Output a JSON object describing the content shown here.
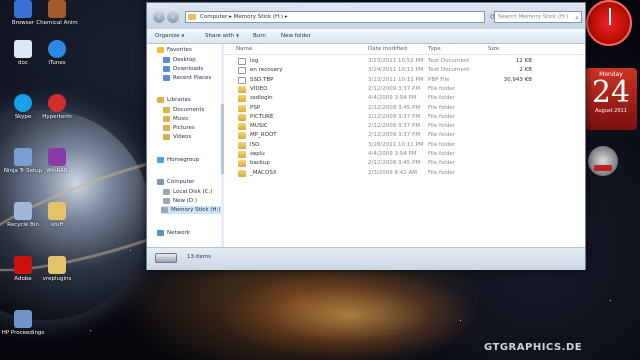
{
  "desktop": {
    "icons": [
      {
        "label": "Browser",
        "color": "#3a6fd8"
      },
      {
        "label": "Chemical Anim",
        "color": "#a45b2c"
      },
      {
        "label": "doc",
        "color": "#dfe6f3"
      },
      {
        "label": "iTunes",
        "color": "#2c88e0"
      },
      {
        "label": "Skype",
        "color": "#16a1e6"
      },
      {
        "label": "Hyperterm",
        "color": "#d12f2f"
      },
      {
        "label": "Ninja Tr Setup",
        "color": "#7a9ed1"
      },
      {
        "label": "WinRAR",
        "color": "#8a3aa8"
      },
      {
        "label": "Recycle Bin",
        "color": "#9fb7d4"
      },
      {
        "label": "stuff",
        "color": "#e2c36a"
      },
      {
        "label": "Adobe",
        "color": "#cc1111"
      },
      {
        "label": "vreplugins",
        "color": "#e2c36a"
      },
      {
        "label": "HP Proceedings",
        "color": "#6f95c8"
      }
    ],
    "calendar": {
      "month": "Monday",
      "day": "24",
      "year": "August 2011"
    },
    "gauge_label": "",
    "watermark": "GTGRAPHICS.DE"
  },
  "window": {
    "address": "Computer ▸ Memory Stick (H:) ▸",
    "search_placeholder": "Search Memory Stick (H:)",
    "toolbar": {
      "organize": "Organize",
      "share": "Share with",
      "burn": "Burn",
      "new_folder": "New folder"
    },
    "nav": {
      "favorites": "Favorites",
      "desktop": "Desktop",
      "downloads": "Downloads",
      "recent": "Recent Places",
      "libraries": "Libraries",
      "documents": "Documents",
      "music": "Music",
      "pictures": "Pictures",
      "videos": "Videos",
      "homegroup": "Homegroup",
      "computer": "Computer",
      "local_disk": "Local Disk (C:)",
      "new_vol": "New (D:)",
      "memory_stick": "Memory Stick (H:)",
      "network": "Network"
    },
    "columns": {
      "name": "Name",
      "date": "Date modified",
      "type": "Type",
      "size": "Size"
    },
    "files": [
      {
        "name": "log",
        "date": "3/23/2011 10:52 PM",
        "type": "Text Document",
        "size": "12 KB",
        "kind": "file"
      },
      {
        "name": "en recovery",
        "date": "3/24/2011 10:11 PM",
        "type": "Text Document",
        "size": "2 KB",
        "kind": "file"
      },
      {
        "name": "SSD.TBP",
        "date": "3/23/2011 10:11 PM",
        "type": "PBP File",
        "size": "30,943 KB",
        "kind": "file"
      },
      {
        "name": "VIDEO",
        "date": "2/12/2009 3:37 PM",
        "type": "File folder",
        "size": "",
        "kind": "folder"
      },
      {
        "name": "ssdlogin",
        "date": "4/4/2009 3:54 PM",
        "type": "File folder",
        "size": "",
        "kind": "folder"
      },
      {
        "name": "PSP",
        "date": "2/12/2009 3:45 PM",
        "type": "File folder",
        "size": "",
        "kind": "folder"
      },
      {
        "name": "PICTURE",
        "date": "2/12/2009 3:37 PM",
        "type": "File folder",
        "size": "",
        "kind": "folder"
      },
      {
        "name": "MUSIC",
        "date": "2/12/2009 3:37 PM",
        "type": "File folder",
        "size": "",
        "kind": "folder"
      },
      {
        "name": "MP_ROOT",
        "date": "2/12/2009 3:37 PM",
        "type": "File folder",
        "size": "",
        "kind": "folder"
      },
      {
        "name": "ISO",
        "date": "3/28/2011 10:11 PM",
        "type": "File folder",
        "size": "",
        "kind": "folder"
      },
      {
        "name": "seplu",
        "date": "4/4/2009 3:54 PM",
        "type": "File folder",
        "size": "",
        "kind": "folder"
      },
      {
        "name": "backup",
        "date": "2/12/2009 3:45 PM",
        "type": "File folder",
        "size": "",
        "kind": "folder"
      },
      {
        "name": "_MACOSX",
        "date": "2/3/2009 8:41 AM",
        "type": "File folder",
        "size": "",
        "kind": "folder"
      }
    ],
    "status": "13 items"
  }
}
